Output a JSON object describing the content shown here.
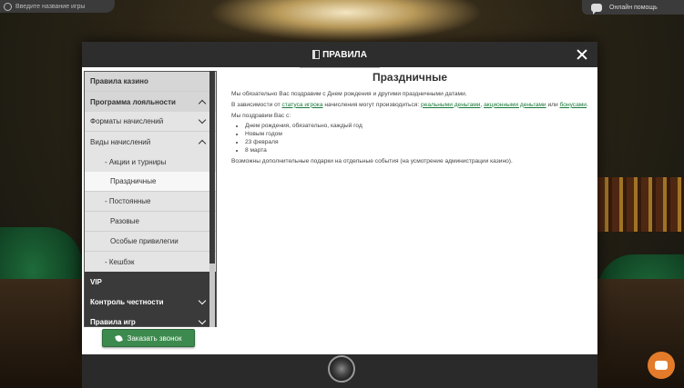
{
  "search": {
    "placeholder": "Введите название игры"
  },
  "help": {
    "label": "Онлайн помощь"
  },
  "modal": {
    "title": "ПРАВИЛА"
  },
  "sidebar": {
    "items": [
      {
        "label": "Правила казино"
      },
      {
        "label": "Программа лояльности"
      },
      {
        "label": "Форматы начислений"
      },
      {
        "label": "Виды начислений"
      },
      {
        "label": "- Акции и турниры"
      },
      {
        "label": "Праздничные"
      },
      {
        "label": "- Постоянные"
      },
      {
        "label": "Разовые"
      },
      {
        "label": "Особые привилегии"
      },
      {
        "label": "- Кешбэк"
      },
      {
        "label": "VIP"
      },
      {
        "label": "Контроль честности"
      },
      {
        "label": "Правила игр"
      }
    ],
    "call_button": "Заказать звонок"
  },
  "content": {
    "title": "Праздничные",
    "p1": "Мы обязательно Вас поздравим с Днем рождения и другими праздничными датами.",
    "p2_pre": "В зависимости от ",
    "p2_link1": "статуса игрока",
    "p2_mid": " начисления могут производиться: ",
    "p2_link2": "реальными деньгами",
    "p2_sep": ", ",
    "p2_link3": "акционными деньгами",
    "p2_or": " или ",
    "p2_link4": "бонусами",
    "p2_end": ".",
    "p3": "Мы поздравим Вас с:",
    "list": [
      "Днем рождения, обязательно, каждый год",
      "Новым годом",
      "23 февраля",
      "8 марта"
    ],
    "p4": "Возможны дополнительные подарки на отдельные события (на усмотрение администрации казино)."
  }
}
